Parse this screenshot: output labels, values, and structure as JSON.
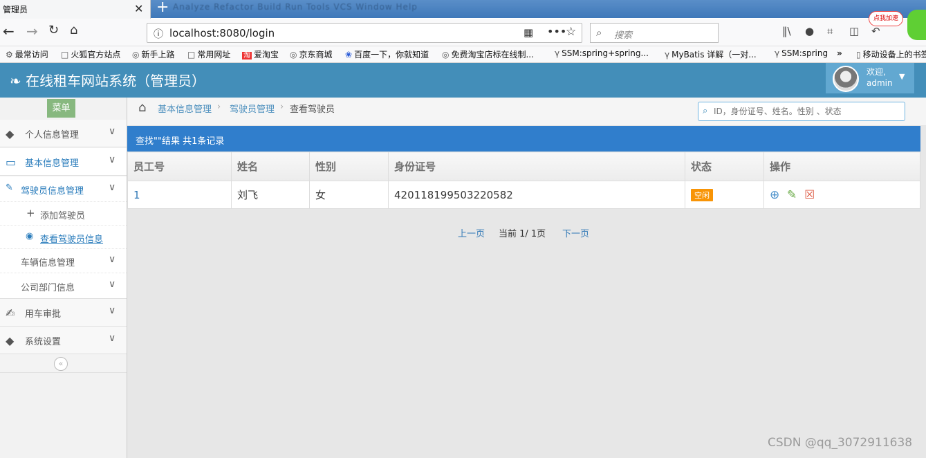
{
  "browser": {
    "tab_title": "管理员",
    "tab_close": "✕",
    "new_tab": "+",
    "blurred_menu": "Analyze  Refactor  Build  Run  Tools  VCS  Window  Help",
    "url": "localhost:8080/login",
    "search_placeholder": "搜索",
    "gift_label": "点我加速"
  },
  "bookmarks": [
    {
      "label": "最常访问",
      "icon": "gear-icon"
    },
    {
      "label": "火狐官方站点",
      "icon": "folder-icon"
    },
    {
      "label": "新手上路",
      "icon": "globe-icon"
    },
    {
      "label": "常用网址",
      "icon": "folder-icon"
    },
    {
      "label": "爱淘宝",
      "icon": "taobao-icon"
    },
    {
      "label": "京东商城",
      "icon": "globe-icon"
    },
    {
      "label": "百度一下，你就知道",
      "icon": "baidu-icon"
    },
    {
      "label": "免费淘宝店标在线制...",
      "icon": "globe-icon"
    },
    {
      "label": "SSM:spring+spring...",
      "icon": "bookmark-icon"
    },
    {
      "label": "MyBatis 详解（一对...",
      "icon": "bookmark-icon"
    },
    {
      "label": "SSM:spring",
      "icon": "bookmark-icon"
    },
    {
      "label": "移动设备上的书签",
      "icon": "phone-icon"
    }
  ],
  "app": {
    "brand": "在线租车网站系统（管理员）",
    "welcome": "欢迎,",
    "username": "admin"
  },
  "sidebar": {
    "menu_label": "菜单",
    "items": [
      {
        "label": "个人信息管理",
        "icon": "tag-icon"
      },
      {
        "label": "基本信息管理",
        "icon": "desktop-icon"
      },
      {
        "label": "驾驶员信息管理",
        "icon": "pencil-icon"
      },
      {
        "label": "添加驾驶员",
        "icon": "plus-icon"
      },
      {
        "label": "查看驾驶员信息",
        "icon": "eye-icon"
      },
      {
        "label": "车辆信息管理",
        "icon": ""
      },
      {
        "label": "公司部门信息",
        "icon": ""
      },
      {
        "label": "用车审批",
        "icon": "edit-icon"
      },
      {
        "label": "系统设置",
        "icon": "tag-icon"
      }
    ],
    "collapse_glyph": "«"
  },
  "breadcrumb": {
    "items": [
      "基本信息管理",
      "驾驶员管理",
      "查看驾驶员"
    ],
    "search_placeholder": "ID，身份证号、姓名。性别 、状态"
  },
  "results": {
    "summary": "查找\"\"结果 共1条记录",
    "columns": [
      "员工号",
      "姓名",
      "性别",
      "身份证号",
      "状态",
      "操作"
    ],
    "rows": [
      {
        "id": "1",
        "name": "刘飞",
        "gender": "女",
        "id_card": "420118199503220582",
        "status": "空闲"
      }
    ]
  },
  "pager": {
    "prev": "上一页",
    "current": "当前 1/ 1页",
    "next": "下一页"
  },
  "watermark": "CSDN @qq_3072911638",
  "colors": {
    "header": "#438eb9",
    "result_bar": "#307ecc",
    "status_badge": "#f89406",
    "menu_label": "#87b87f"
  }
}
